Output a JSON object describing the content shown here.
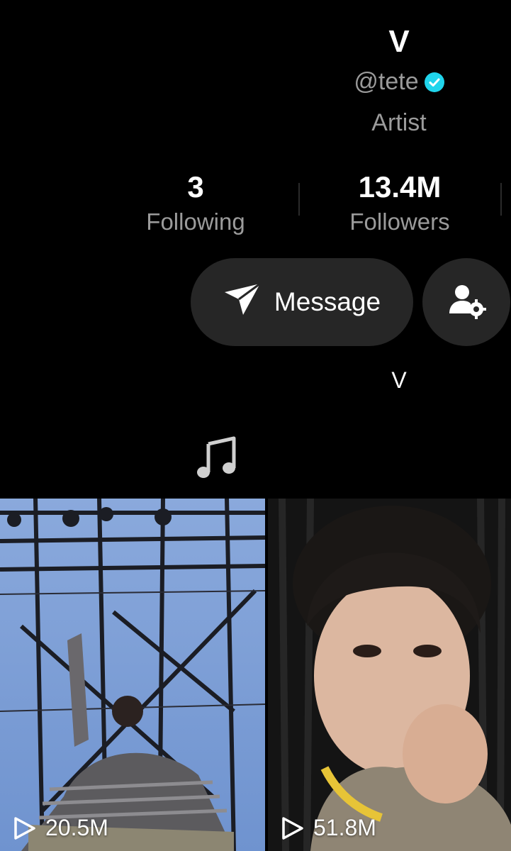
{
  "profile": {
    "name": "V",
    "handle": "@tete",
    "category": "Artist",
    "bio": "V"
  },
  "stats": {
    "following_count": "3",
    "following_label": "Following",
    "followers_count": "13.4M",
    "followers_label": "Followers"
  },
  "actions": {
    "message_label": "Message"
  },
  "videos": [
    {
      "views": "20.5M"
    },
    {
      "views": "51.8M"
    }
  ],
  "colors": {
    "background": "#000000",
    "button_bg": "#262626",
    "secondary_text": "#9b9b9b",
    "verified": "#20d5ec"
  }
}
